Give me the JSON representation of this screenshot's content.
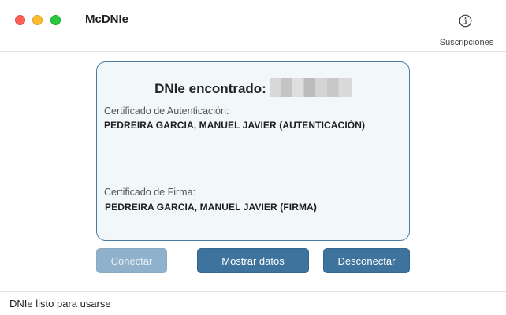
{
  "window": {
    "app_title": "McDNIe",
    "toolbar": {
      "subscriptions_label": "Suscripciones",
      "icon": "info-circle-icon"
    }
  },
  "card": {
    "title": "DNIe encontrado:",
    "auth_cert_label": "Certificado de Autenticación:",
    "auth_cert_value": "PEDREIRA GARCIA, MANUEL JAVIER (AUTENTICACIÓN)",
    "sign_cert_label": "Certificado de Firma:",
    "sign_cert_value": "PEDREIRA GARCIA, MANUEL JAVIER (FIRMA)"
  },
  "buttons": {
    "connect": "Conectar",
    "show_data": "Mostrar datos",
    "disconnect": "Desconectar"
  },
  "status": {
    "text": "DNIe listo para usarse"
  },
  "colors": {
    "accent": "#3d739d",
    "card_bg": "#f2f7fa",
    "card_border": "#4a7ba2"
  }
}
